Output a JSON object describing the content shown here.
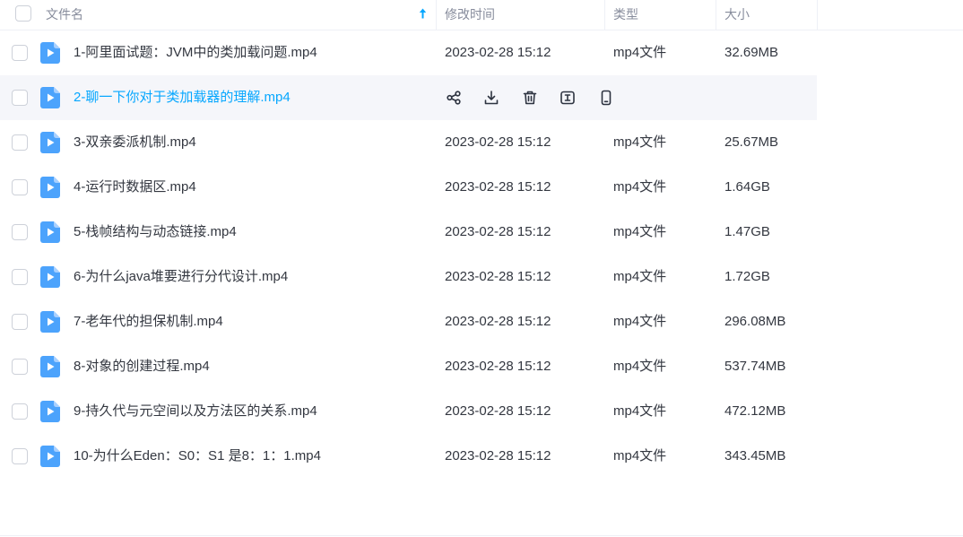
{
  "header": {
    "select_all_checked": false,
    "columns": {
      "name": "文件名",
      "modified": "修改时间",
      "type": "类型",
      "size": "大小"
    },
    "sort_icon": "sort-ascending-icon"
  },
  "files": [
    {
      "name": "1-阿里面试题：JVM中的类加载问题.mp4",
      "modified": "2023-02-28 15:12",
      "type": "mp4文件",
      "size": "32.69MB",
      "checked": false,
      "icon": "video-file-icon"
    },
    {
      "name": "2-聊一下你对于类加载器的理解.mp4",
      "checked": false,
      "hovered": true,
      "icon": "video-file-icon",
      "actions": [
        "share-icon",
        "download-icon",
        "delete-icon",
        "rename-icon",
        "send-to-phone-icon"
      ]
    },
    {
      "name": "3-双亲委派机制.mp4",
      "modified": "2023-02-28 15:12",
      "type": "mp4文件",
      "size": "25.67MB",
      "checked": false,
      "icon": "video-file-icon"
    },
    {
      "name": "4-运行时数据区.mp4",
      "modified": "2023-02-28 15:12",
      "type": "mp4文件",
      "size": "1.64GB",
      "checked": false,
      "icon": "video-file-icon"
    },
    {
      "name": "5-栈帧结构与动态链接.mp4",
      "modified": "2023-02-28 15:12",
      "type": "mp4文件",
      "size": "1.47GB",
      "checked": false,
      "icon": "video-file-icon"
    },
    {
      "name": "6-为什么java堆要进行分代设计.mp4",
      "modified": "2023-02-28 15:12",
      "type": "mp4文件",
      "size": "1.72GB",
      "checked": false,
      "icon": "video-file-icon"
    },
    {
      "name": "7-老年代的担保机制.mp4",
      "modified": "2023-02-28 15:12",
      "type": "mp4文件",
      "size": "296.08MB",
      "checked": false,
      "icon": "video-file-icon"
    },
    {
      "name": "8-对象的创建过程.mp4",
      "modified": "2023-02-28 15:12",
      "type": "mp4文件",
      "size": "537.74MB",
      "checked": false,
      "icon": "video-file-icon"
    },
    {
      "name": "9-持久代与元空间以及方法区的关系.mp4",
      "modified": "2023-02-28 15:12",
      "type": "mp4文件",
      "size": "472.12MB",
      "checked": false,
      "icon": "video-file-icon"
    },
    {
      "name": "10-为什么Eden：S0：S1 是8：1：1.mp4",
      "modified": "2023-02-28 15:12",
      "type": "mp4文件",
      "size": "343.45MB",
      "checked": false,
      "icon": "video-file-icon"
    }
  ],
  "colors": {
    "accent": "#06a7ff",
    "text": "#333740",
    "header_text": "#878c9c",
    "hover_row_bg": "#f5f6fa",
    "file_icon": "#4ca3fc",
    "divider": "#eef0f6"
  }
}
